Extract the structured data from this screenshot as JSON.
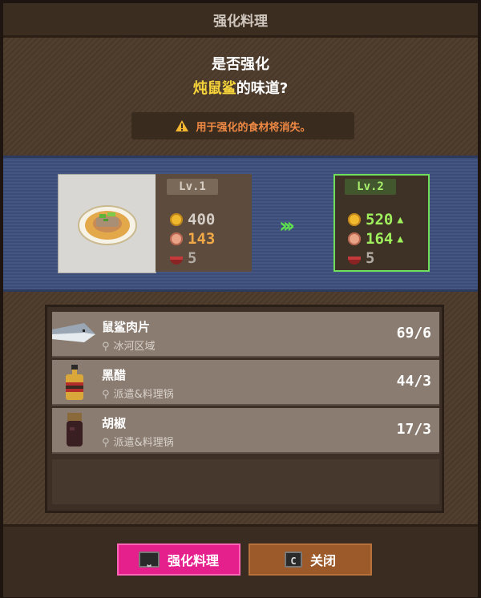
{
  "title": "强化料理",
  "question": {
    "line1": "是否强化",
    "dish_name": "炖鼠鲨",
    "line2_suffix": "的味道?"
  },
  "warning": "用于强化的食材将消失。",
  "current": {
    "level": "Lv.1",
    "price": "400",
    "taste": "143",
    "servings": "5"
  },
  "next": {
    "level": "Lv.2",
    "price": "520",
    "taste": "164",
    "servings": "5"
  },
  "ingredients": [
    {
      "name": "鼠鲨肉片",
      "location": "冰河区域",
      "count": "69/6"
    },
    {
      "name": "黑醋",
      "location": "派遣&料理锅",
      "count": "44/3"
    },
    {
      "name": "胡椒",
      "location": "派遣&料理锅",
      "count": "17/3"
    }
  ],
  "buttons": {
    "confirm_label": "强化料理",
    "confirm_key": "⎵",
    "close_label": "关闭",
    "close_key": "C"
  },
  "icons": {
    "warning": "warning-icon",
    "price": "gold-coin-icon",
    "taste": "taste-face-icon",
    "servings": "bowl-icon",
    "location": "location-pin-icon",
    "level_up": "chevron-triple-right-icon"
  },
  "colors": {
    "highlight": "#f6d43a",
    "warning_text": "#f08a44",
    "upgrade_green": "#9ff05c",
    "confirm_button": "#e51f8c",
    "close_button": "#9c5a2a"
  }
}
